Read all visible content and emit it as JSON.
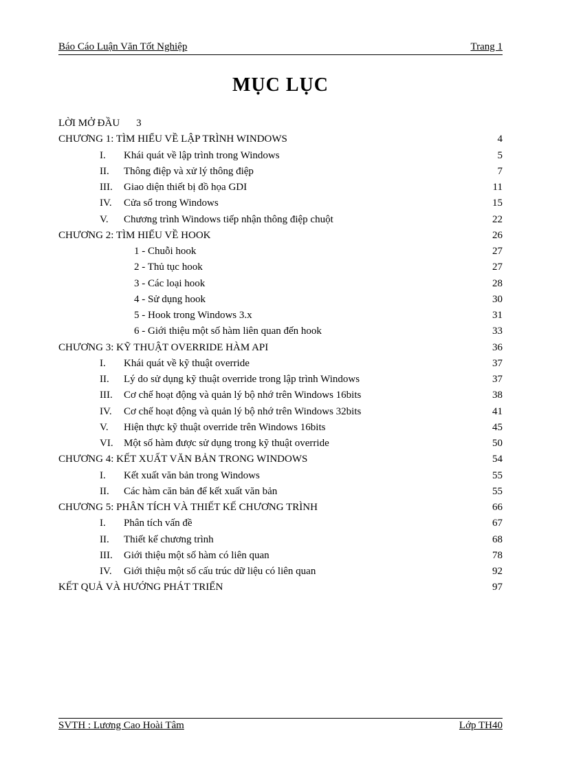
{
  "header": {
    "left": "Báo Cáo Luận Văn Tốt Nghiệp",
    "right": "Trang  1"
  },
  "title": "MỤC  LỤC",
  "intro": {
    "label": "LỜI MỞ ĐẦU",
    "page": "3"
  },
  "chapters": [
    {
      "title": "CHƯƠNG 1: TÌM HIỂU VỀ LẬP TRÌNH WINDOWS",
      "page": "4",
      "style": "roman",
      "items": [
        {
          "num": "I.",
          "text": "Khái quát về lập trình trong Windows",
          "page": "5"
        },
        {
          "num": "II.",
          "text": "Thông điệp và xử lý thông điệp",
          "page": "7"
        },
        {
          "num": "III.",
          "text": "Giao diện thiết bị đồ họa GDI",
          "page": "11"
        },
        {
          "num": "IV.",
          "text": "Cửa sổ trong Windows",
          "page": "15"
        },
        {
          "num": "V.",
          "text": "Chương trình Windows tiếp nhận thông điệp chuột",
          "page": "22"
        }
      ]
    },
    {
      "title": "CHƯƠNG 2: TÌM HIỂU VỀ HOOK",
      "page": "26",
      "style": "dash",
      "items": [
        {
          "num": "1 -",
          "text": "Chuỗi hook",
          "page": "27"
        },
        {
          "num": "2 -",
          "text": "Thủ tục hook",
          "page": "27"
        },
        {
          "num": "3 -",
          "text": "Các loại hook",
          "page": "28"
        },
        {
          "num": "4 -",
          "text": "Sử dụng hook",
          "page": "30"
        },
        {
          "num": "5 -",
          "text": "Hook trong Windows 3.x",
          "page": "31"
        },
        {
          "num": "6 -",
          "text": "Giới thiệu một số hàm liên quan đến hook",
          "page": "33"
        }
      ]
    },
    {
      "title": "CHƯƠNG 3: KỸ THUẬT  OVERRIDE  HÀM API",
      "page": "36",
      "style": "roman",
      "items": [
        {
          "num": "I.",
          "text": "Khái quát về kỹ thuật override",
          "page": "37"
        },
        {
          "num": "II.",
          "text": "Lý do sử dụng kỹ thuật override trong lập trình Windows",
          "page": "37"
        },
        {
          "num": "III.",
          "text": "Cơ chế hoạt động và quản lý bộ nhớ trên Windows 16bits",
          "page": "38"
        },
        {
          "num": "IV.",
          "text": "Cơ chế hoạt động và quản lý bộ nhớ trên Windows 32bits",
          "page": "41"
        },
        {
          "num": "V.",
          "text": "Hiện thực kỹ thuật override trên Windows 16bits",
          "page": "45"
        },
        {
          "num": "VI.",
          "text": "Một số hàm được sử dụng trong kỹ thuật override",
          "page": "50"
        }
      ]
    },
    {
      "title": "CHƯƠNG 4: KẾT XUẤT VĂN BẢN TRONG WINDOWS",
      "page": "54",
      "style": "roman",
      "items": [
        {
          "num": "I.",
          "text": "Kết xuất văn bản trong Windows",
          "page": "55"
        },
        {
          "num": "II.",
          "text": "Các hàm căn bản để kết xuất văn bản",
          "page": "55"
        }
      ]
    },
    {
      "title": "CHƯƠNG 5: PHÂN TÍCH VÀ THIẾT KẾ CHƯƠNG TRÌNH",
      "page": "66",
      "style": "roman",
      "items": [
        {
          "num": "I.",
          "text": "Phân tích vấn đề",
          "page": "67"
        },
        {
          "num": "II.",
          "text": "Thiết kế chương trình",
          "page": "68"
        },
        {
          "num": "III.",
          "text": "Giới thiệu một số hàm có liên quan",
          "page": "78"
        },
        {
          "num": "IV.",
          "text": "Giới thiệu một số cấu trúc dữ liệu có liên quan",
          "page": "92"
        }
      ]
    }
  ],
  "closing": {
    "title": "KẾT QUẢ VÀ HƯỚNG PHÁT TRIỂN",
    "page": "97"
  },
  "footer": {
    "left": "SVTH  : Lương Cao Hoài Tâm",
    "right": "Lớp TH40"
  }
}
